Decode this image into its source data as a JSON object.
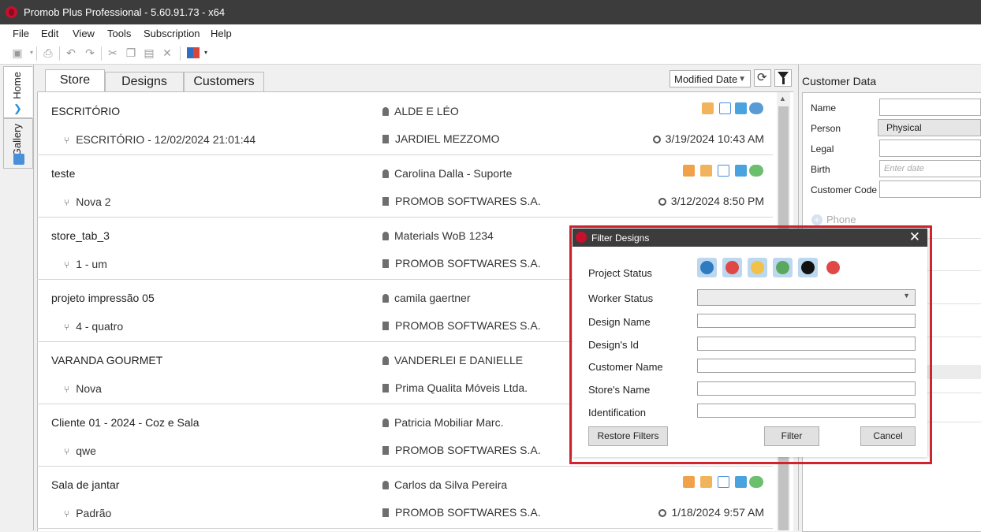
{
  "window": {
    "title": "Promob Plus Professional - 5.60.91.73 - x64"
  },
  "menu": [
    "File",
    "Edit",
    "View",
    "Tools",
    "Subscription",
    "Help"
  ],
  "side_tabs": {
    "home": "Home",
    "gallery": "Gallery"
  },
  "tabs": [
    "Store",
    "Designs",
    "Customers"
  ],
  "sort": {
    "selected": "Modified Date"
  },
  "designs": [
    {
      "name": "ESCRITÓRIO",
      "customer": "ALDE E LÉO",
      "version": "ESCRITÓRIO - 12/02/2024 21:01:44",
      "store": "JARDIEL MEZZOMO",
      "date": "3/19/2024 10:43 AM"
    },
    {
      "name": "teste",
      "customer": "Carolina Dalla - Suporte",
      "version": "Nova 2",
      "store": "PROMOB SOFTWARES S.A.",
      "date": "3/12/2024 8:50 PM"
    },
    {
      "name": "store_tab_3",
      "customer": "Materials WoB 1234",
      "version": "1 - um",
      "store": "PROMOB SOFTWARES S.A.",
      "date": ""
    },
    {
      "name": "projeto impressão 05",
      "customer": "camila gaertner",
      "version": "4 - quatro",
      "store": "PROMOB SOFTWARES S.A.",
      "date": ""
    },
    {
      "name": "VARANDA GOURMET",
      "customer": "VANDERLEI E DANIELLE",
      "version": "Nova",
      "store": "Prima Qualita Móveis Ltda.",
      "date": ""
    },
    {
      "name": "Cliente 01 - 2024 - Coz e Sala",
      "customer": "Patricia Mobiliar Marc.",
      "version": "qwe",
      "store": "PROMOB SOFTWARES S.A.",
      "date": ""
    },
    {
      "name": "Sala de jantar",
      "customer": "Carlos da Silva Pereira",
      "version": "Padrão",
      "store": "PROMOB SOFTWARES S.A.",
      "date": "1/18/2024 9:57 AM"
    }
  ],
  "customer_panel": {
    "title": "Customer Data",
    "fields": {
      "name": "Name",
      "person": "Person",
      "person_value": "Physical",
      "legal": "Legal",
      "birth": "Birth",
      "birth_placeholder": "Enter date",
      "customer_code": "Customer Code"
    },
    "phone": "Phone"
  },
  "filter_dialog": {
    "title": "Filter Designs",
    "labels": {
      "project_status": "Project Status",
      "worker_status": "Worker Status",
      "design_name": "Design Name",
      "design_id": "Design's Id",
      "customer_name": "Customer Name",
      "store_name": "Store's Name",
      "identification": "Identification"
    },
    "status_icons": [
      "play-icon",
      "cancel-icon",
      "pause-icon",
      "check-icon",
      "double-check-icon",
      "blocked-icon"
    ],
    "buttons": {
      "restore": "Restore Filters",
      "filter": "Filter",
      "cancel": "Cancel"
    }
  },
  "colors": {
    "highlight": "#d1242f",
    "titlebar": "#3c3c3c",
    "brand": "#c8102e"
  }
}
